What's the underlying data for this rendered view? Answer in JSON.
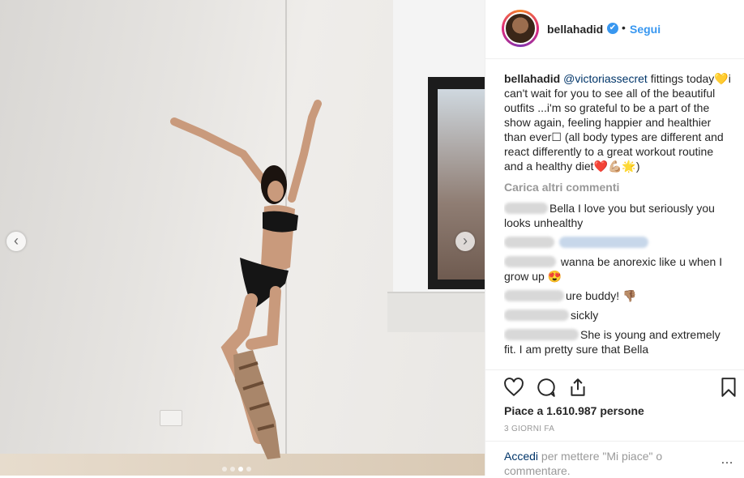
{
  "header": {
    "username": "bellahadid",
    "verified_mark": "✔",
    "separator": "•",
    "follow_label": "Segui"
  },
  "caption": {
    "author": "bellahadid",
    "mention": "@victoriassecret",
    "text_1": " fittings today💛i can't wait for you to see all of the beautiful outfits ...i'm so grateful to be a part of the show again, feeling happier and healthier than ever☐ (all body types are different and react differently to a great workout routine and a healthy diet❤️💪🏼🌟)"
  },
  "load_more": "Carica altri commenti",
  "comments": [
    {
      "text": "Bella I love you but seriously you looks unhealthy"
    },
    {
      "text": ""
    },
    {
      "text": " wanna be anorexic like u when I grow up 😍"
    },
    {
      "text": "ure buddy! 👎🏽"
    },
    {
      "text": "sickly"
    },
    {
      "text": "She is young and extremely fit. I am pretty sure that Bella"
    }
  ],
  "likes": "Piace a 1.610.987 persone",
  "time": "3 GIORNI FA",
  "footer": {
    "login_link": "Accedi",
    "login_text": " per mettere \"Mi piace\" o commentare.",
    "more_icon": "…"
  },
  "nav": {
    "prev": "‹",
    "next": "›"
  },
  "icons": [
    "heart-icon",
    "comment-icon",
    "share-icon",
    "bookmark-icon"
  ],
  "colors": {
    "accent": "#3897f0",
    "link": "#003569",
    "muted": "#999999"
  }
}
